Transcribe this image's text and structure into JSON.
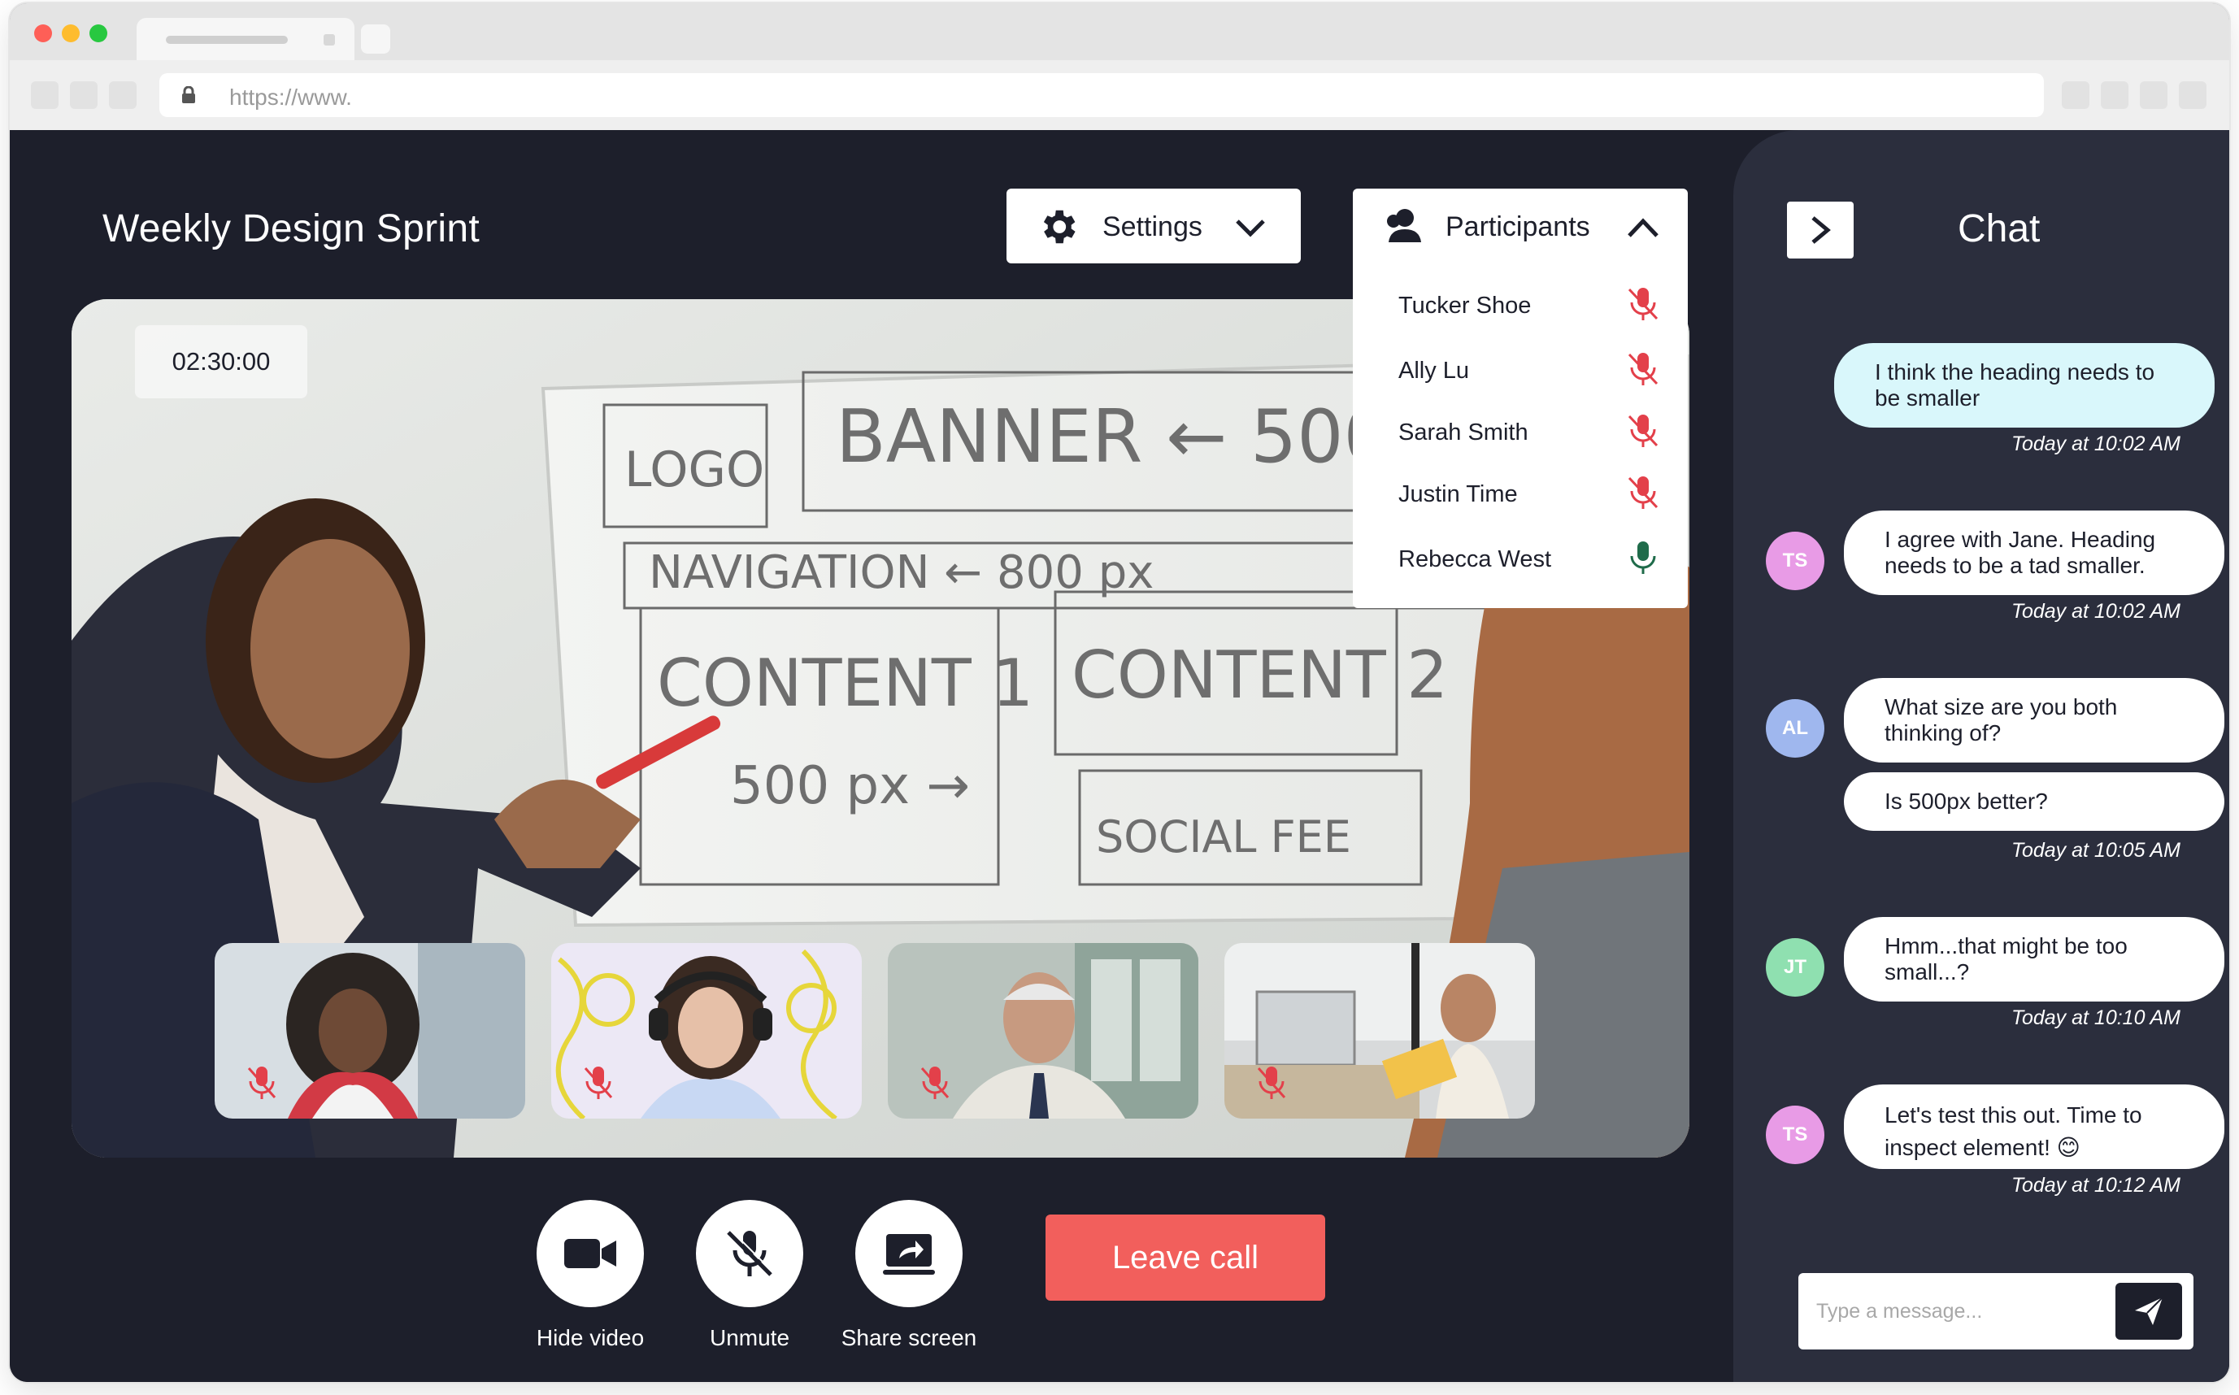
{
  "browser": {
    "url": "https://www."
  },
  "meeting": {
    "title": "Weekly Design Sprint",
    "timer": "02:30:00"
  },
  "settings": {
    "label": "Settings",
    "icon": "gear-icon"
  },
  "participants": {
    "label": "Participants",
    "list": [
      {
        "name": "Tucker Shoe",
        "muted": true
      },
      {
        "name": "Ally Lu",
        "muted": true
      },
      {
        "name": "Sarah Smith",
        "muted": true
      },
      {
        "name": "Justin Time",
        "muted": true
      },
      {
        "name": "Rebecca West",
        "muted": false
      }
    ]
  },
  "controls": {
    "hide_video": "Hide video",
    "unmute": "Unmute",
    "share_screen": "Share screen",
    "leave": "Leave call"
  },
  "chat": {
    "title": "Chat",
    "placeholder": "Type a message...",
    "messages": [
      {
        "text": "I think the heading needs to be smaller",
        "time": "Today at 10:02 AM",
        "mine": true
      },
      {
        "initials": "TS",
        "text": "I agree with Jane. Heading needs to be a tad smaller.",
        "time": "Today at 10:02 AM"
      },
      {
        "initials": "AL",
        "text": "What size are you both thinking of?"
      },
      {
        "text": "Is 500px better?",
        "time": "Today at 10:05 AM"
      },
      {
        "initials": "JT",
        "text": "Hmm...that might be too small...?",
        "time": "Today at 10:10 AM"
      },
      {
        "initials": "TS",
        "text": "Let's test this out. Time to inspect element! 😊",
        "time": "Today at 10:12 AM"
      }
    ]
  },
  "colors": {
    "background": "#1d1f2b",
    "chat_panel": "#2b2e3d",
    "leave": "#f25f5c",
    "muted_mic": "#e3404a",
    "active_mic": "#1f6b4a",
    "avatar_ts": "#e89be6",
    "avatar_al": "#9fb7ee",
    "avatar_jt": "#8fe0b0"
  }
}
